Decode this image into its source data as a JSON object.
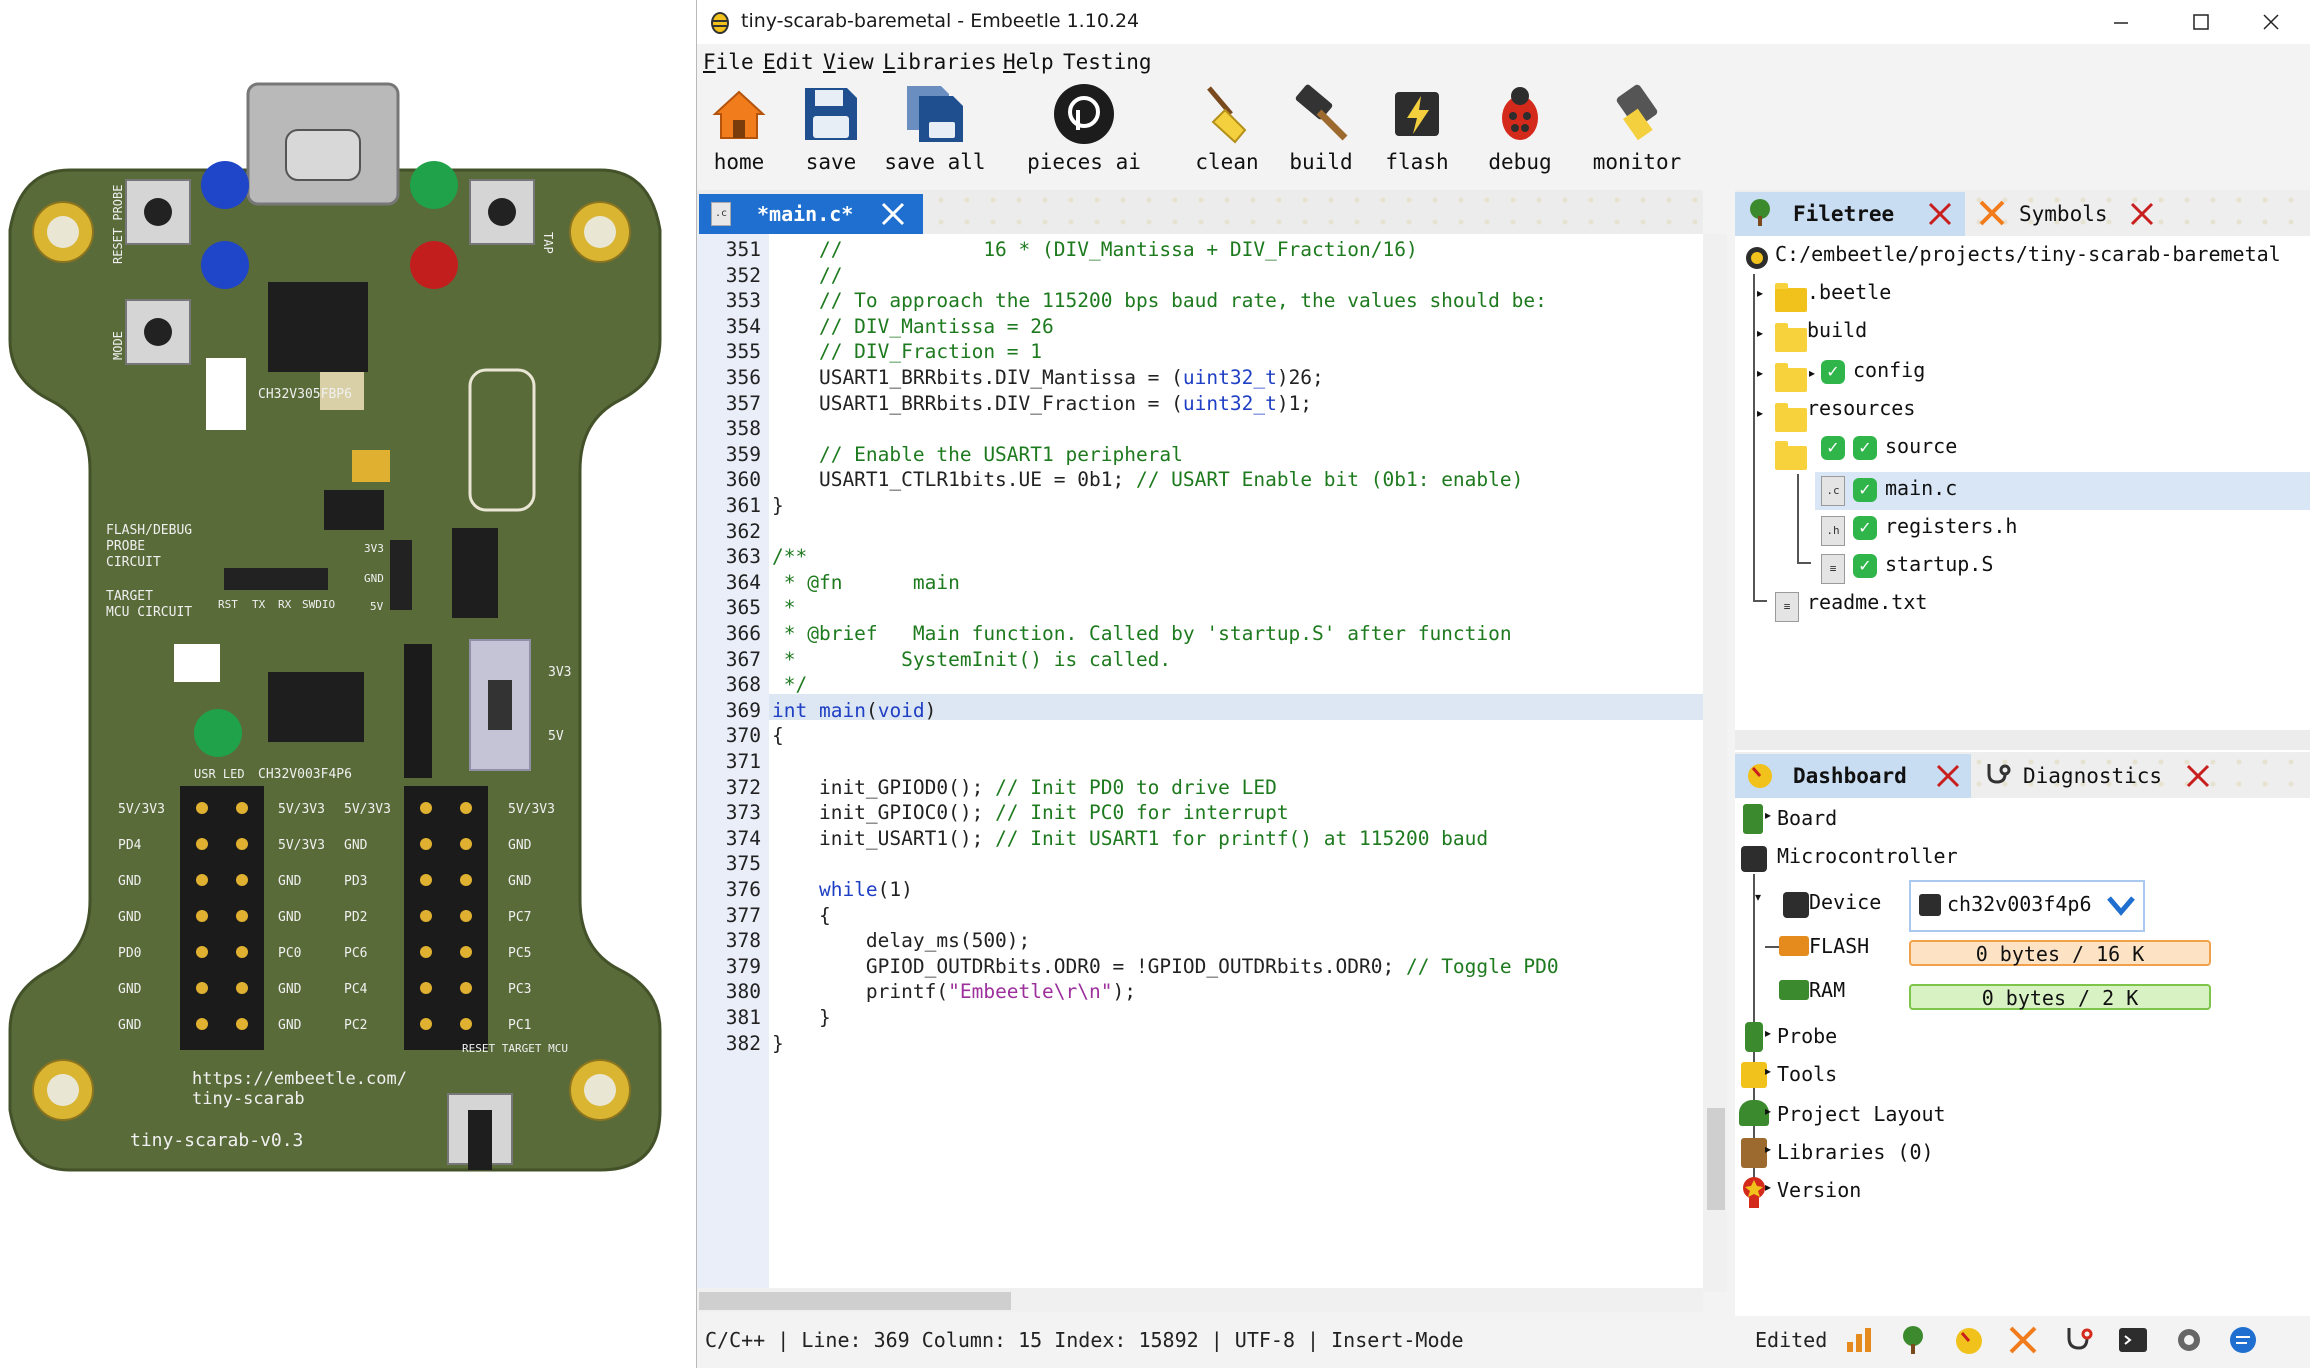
{
  "window": {
    "title": "tiny-scarab-baremetal - Embeetle 1.10.24",
    "controls": [
      "minimize",
      "maximize",
      "close"
    ]
  },
  "menu": [
    {
      "key": "F",
      "rest": "ile"
    },
    {
      "key": "E",
      "rest": "dit"
    },
    {
      "key": "V",
      "rest": "iew"
    },
    {
      "key": "L",
      "rest": "ibraries"
    },
    {
      "key": "H",
      "rest": "elp"
    },
    {
      "key": "",
      "rest": "Testing"
    }
  ],
  "toolbar": {
    "home": "home",
    "save": "save",
    "save_all": "save all",
    "pieces_ai": "pieces ai",
    "clean": "clean",
    "build": "build",
    "flash": "flash",
    "debug": "debug",
    "monitor": "monitor"
  },
  "editor": {
    "tab_label": "*main.c*",
    "tab_file_ext": ".c",
    "lines": [
      {
        "n": "351",
        "segs": [
          [
            "cm",
            "    //            16 * (DIV_Mantissa + DIV_Fraction/16)"
          ]
        ]
      },
      {
        "n": "352",
        "segs": [
          [
            "cm",
            "    //"
          ]
        ]
      },
      {
        "n": "353",
        "segs": [
          [
            "cm",
            "    // To approach the 115200 bps baud rate, the values should be:"
          ]
        ]
      },
      {
        "n": "354",
        "segs": [
          [
            "cm",
            "    // DIV_Mantissa = 26"
          ]
        ]
      },
      {
        "n": "355",
        "segs": [
          [
            "cm",
            "    // DIV_Fraction = 1"
          ]
        ]
      },
      {
        "n": "356",
        "segs": [
          [
            "nm",
            "    USART1_BRRbits.DIV_Mantissa = ("
          ],
          [
            "ty",
            "uint32_t"
          ],
          [
            "nm",
            ")26;"
          ]
        ]
      },
      {
        "n": "357",
        "segs": [
          [
            "nm",
            "    USART1_BRRbits.DIV_Fraction = ("
          ],
          [
            "ty",
            "uint32_t"
          ],
          [
            "nm",
            ")1;"
          ]
        ]
      },
      {
        "n": "358",
        "segs": [
          [
            "nm",
            ""
          ]
        ]
      },
      {
        "n": "359",
        "segs": [
          [
            "cm",
            "    // Enable the USART1 peripheral"
          ]
        ]
      },
      {
        "n": "360",
        "segs": [
          [
            "nm",
            "    USART1_CTLR1bits.UE = 0b1; "
          ],
          [
            "cm",
            "// USART Enable bit (0b1: enable)"
          ]
        ]
      },
      {
        "n": "361",
        "segs": [
          [
            "nm",
            "}"
          ]
        ]
      },
      {
        "n": "362",
        "segs": [
          [
            "nm",
            ""
          ]
        ]
      },
      {
        "n": "363",
        "segs": [
          [
            "cm",
            "/**"
          ]
        ]
      },
      {
        "n": "364",
        "segs": [
          [
            "cm",
            " * @fn      main"
          ]
        ]
      },
      {
        "n": "365",
        "segs": [
          [
            "cm",
            " *"
          ]
        ]
      },
      {
        "n": "366",
        "segs": [
          [
            "cm",
            " * @brief   Main function. Called by 'startup.S' after function"
          ]
        ]
      },
      {
        "n": "367",
        "segs": [
          [
            "cm",
            " *         SystemInit() is called."
          ]
        ]
      },
      {
        "n": "368",
        "segs": [
          [
            "cm",
            " */"
          ]
        ]
      },
      {
        "n": "369",
        "segs": [
          [
            "kw",
            "int"
          ],
          [
            "nm",
            " "
          ],
          [
            "ty",
            "main"
          ],
          [
            "nm",
            "("
          ],
          [
            "kw",
            "void"
          ],
          [
            "nm",
            ")"
          ]
        ]
      },
      {
        "n": "370",
        "segs": [
          [
            "nm",
            "{"
          ]
        ]
      },
      {
        "n": "371",
        "segs": [
          [
            "nm",
            ""
          ]
        ]
      },
      {
        "n": "372",
        "segs": [
          [
            "nm",
            "    init_GPIOD0(); "
          ],
          [
            "cm",
            "// Init PD0 to drive LED"
          ]
        ]
      },
      {
        "n": "373",
        "segs": [
          [
            "nm",
            "    init_GPIOC0(); "
          ],
          [
            "cm",
            "// Init PC0 for interrupt"
          ]
        ]
      },
      {
        "n": "374",
        "segs": [
          [
            "nm",
            "    init_USART1(); "
          ],
          [
            "cm",
            "// Init USART1 for printf() at 115200 baud"
          ]
        ]
      },
      {
        "n": "375",
        "segs": [
          [
            "nm",
            ""
          ]
        ]
      },
      {
        "n": "376",
        "segs": [
          [
            "nm",
            "    "
          ],
          [
            "kw",
            "while"
          ],
          [
            "nm",
            "(1)"
          ]
        ]
      },
      {
        "n": "377",
        "segs": [
          [
            "nm",
            "    {"
          ]
        ]
      },
      {
        "n": "378",
        "segs": [
          [
            "nm",
            "        delay_ms(500);"
          ]
        ]
      },
      {
        "n": "379",
        "segs": [
          [
            "nm",
            "        GPIOD_OUTDRbits.ODR0 = !GPIOD_OUTDRbits.ODR0; "
          ],
          [
            "cm",
            "// Toggle PD0"
          ]
        ]
      },
      {
        "n": "380",
        "segs": [
          [
            "nm",
            "        printf("
          ],
          [
            "st",
            "\"Embeetle\\r\\n\""
          ],
          [
            "nm",
            ");"
          ]
        ]
      },
      {
        "n": "381",
        "segs": [
          [
            "nm",
            "    }"
          ]
        ]
      },
      {
        "n": "382",
        "segs": [
          [
            "nm",
            "}"
          ]
        ]
      }
    ]
  },
  "filetree": {
    "tab_label": "Filetree",
    "symbols_tab_label": "Symbols",
    "root": "C:/embeetle/projects/tiny-scarab-baremetal",
    "items": {
      "beetle": ".beetle",
      "build": "build",
      "config": "config",
      "resources": "resources",
      "source": "source",
      "main_c": "main.c",
      "registers_h": "registers.h",
      "startup_s": "startup.S",
      "readme": "readme.txt"
    },
    "file_exts": {
      "c": ".c",
      "h": ".h"
    }
  },
  "dashboard": {
    "tab_label": "Dashboard",
    "diagnostics_tab_label": "Diagnostics",
    "board": "Board",
    "microcontroller": "Microcontroller",
    "device_label": "Device",
    "device_value": "ch32v003f4p6",
    "flash_label": "FLASH",
    "flash_value": "0 bytes / 16 K",
    "ram_label": "RAM",
    "ram_value": "0 bytes / 2 K",
    "probe": "Probe",
    "tools": "Tools",
    "project_layout": "Project Layout",
    "libraries": "Libraries (0)",
    "version": "Version"
  },
  "status": {
    "text": "C/C++ | Line: 369 Column: 15 Index: 15892 | UTF-8 | Insert-Mode",
    "edited": "Edited"
  },
  "pcb": {
    "labels": {
      "reset_probe": "RESET PROBE",
      "mode": "MODE",
      "tap": "TAP",
      "chip1": "CH32V305FBP6",
      "flash_debug": "FLASH/DEBUG",
      "probe": "PROBE",
      "circuit": "CIRCUIT",
      "target": "TARGET",
      "mcu_circuit": "MCU CIRCUIT",
      "rst": "RST",
      "tx": "TX",
      "rx": "RX",
      "swdio": "SWDIO",
      "v3v3": "3V3",
      "gnd": "GND",
      "v5v": "5V",
      "chip2": "CH32V003F4P6",
      "usr_led": "USR LED",
      "url": "https://embeetle.com/",
      "board_name": "tiny-scarab",
      "version": "tiny-scarab-v0.3",
      "reset_target": "RESET TARGET MCU",
      "sw_3v3": "3V3",
      "sw_5v": "5V"
    },
    "pins_left_outer": [
      "5V/3V3",
      "PD4",
      "GND",
      "GND",
      "PD0",
      "GND",
      "GND"
    ],
    "pins_left_inner": [
      "5V/3V3",
      "5V/3V3",
      "GND",
      "GND",
      "PC0",
      "GND",
      "GND"
    ],
    "pins_right_outer": [
      "5V/3V3",
      "GND",
      "PD3",
      "PD2",
      "PC6",
      "PC4",
      "PC2"
    ],
    "pins_right_inner": [
      "5V/3V3",
      "GND",
      "GND",
      "PC7",
      "PC5",
      "PC3",
      "PC1"
    ]
  }
}
